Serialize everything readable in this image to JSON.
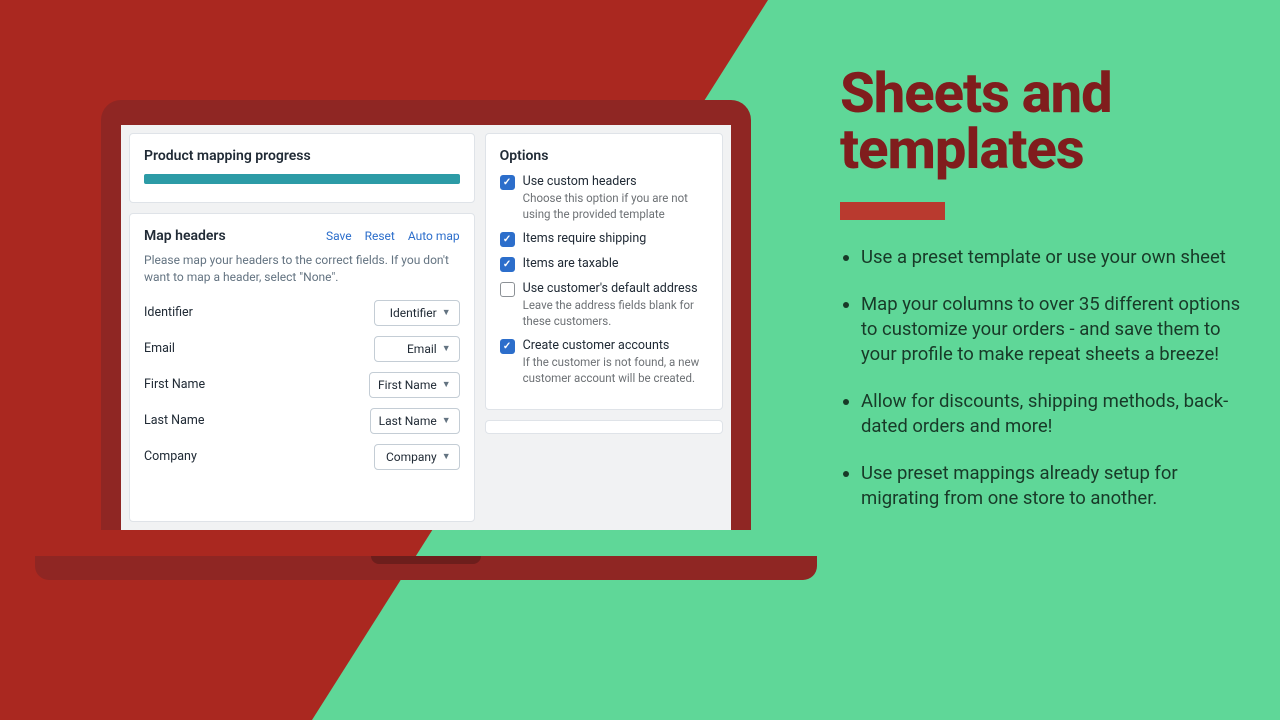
{
  "promo": {
    "title": "Sheets and templates",
    "bullets": [
      "Use a preset template or use your own sheet",
      "Map your columns to over 35 different options to customize your orders - and save them to your profile to make repeat sheets a breeze!",
      "Allow for discounts, shipping methods, back-dated orders and more!",
      "Use preset mappings already setup for migrating from one store to another."
    ]
  },
  "progress": {
    "title": "Product mapping progress"
  },
  "map": {
    "title": "Map headers",
    "save": "Save",
    "reset": "Reset",
    "auto": "Auto map",
    "help": "Please map your headers to the correct fields. If you don't want to map a header, select \"None\".",
    "fields": [
      {
        "label": "Identifier",
        "value": "Identifier"
      },
      {
        "label": "Email",
        "value": "Email"
      },
      {
        "label": "First Name",
        "value": "First Name"
      },
      {
        "label": "Last Name",
        "value": "Last Name"
      },
      {
        "label": "Company",
        "value": "Company"
      }
    ]
  },
  "options": {
    "title": "Options",
    "items": [
      {
        "label": "Use custom headers",
        "checked": true,
        "desc": "Choose this option if you are not using the provided template"
      },
      {
        "label": "Items require shipping",
        "checked": true
      },
      {
        "label": "Items are taxable",
        "checked": true
      },
      {
        "label": "Use customer's default address",
        "checked": false,
        "desc": "Leave the address fields blank for these customers."
      },
      {
        "label": "Create customer accounts",
        "checked": true,
        "desc": "If the customer is not found, a new customer account will be created."
      }
    ]
  }
}
